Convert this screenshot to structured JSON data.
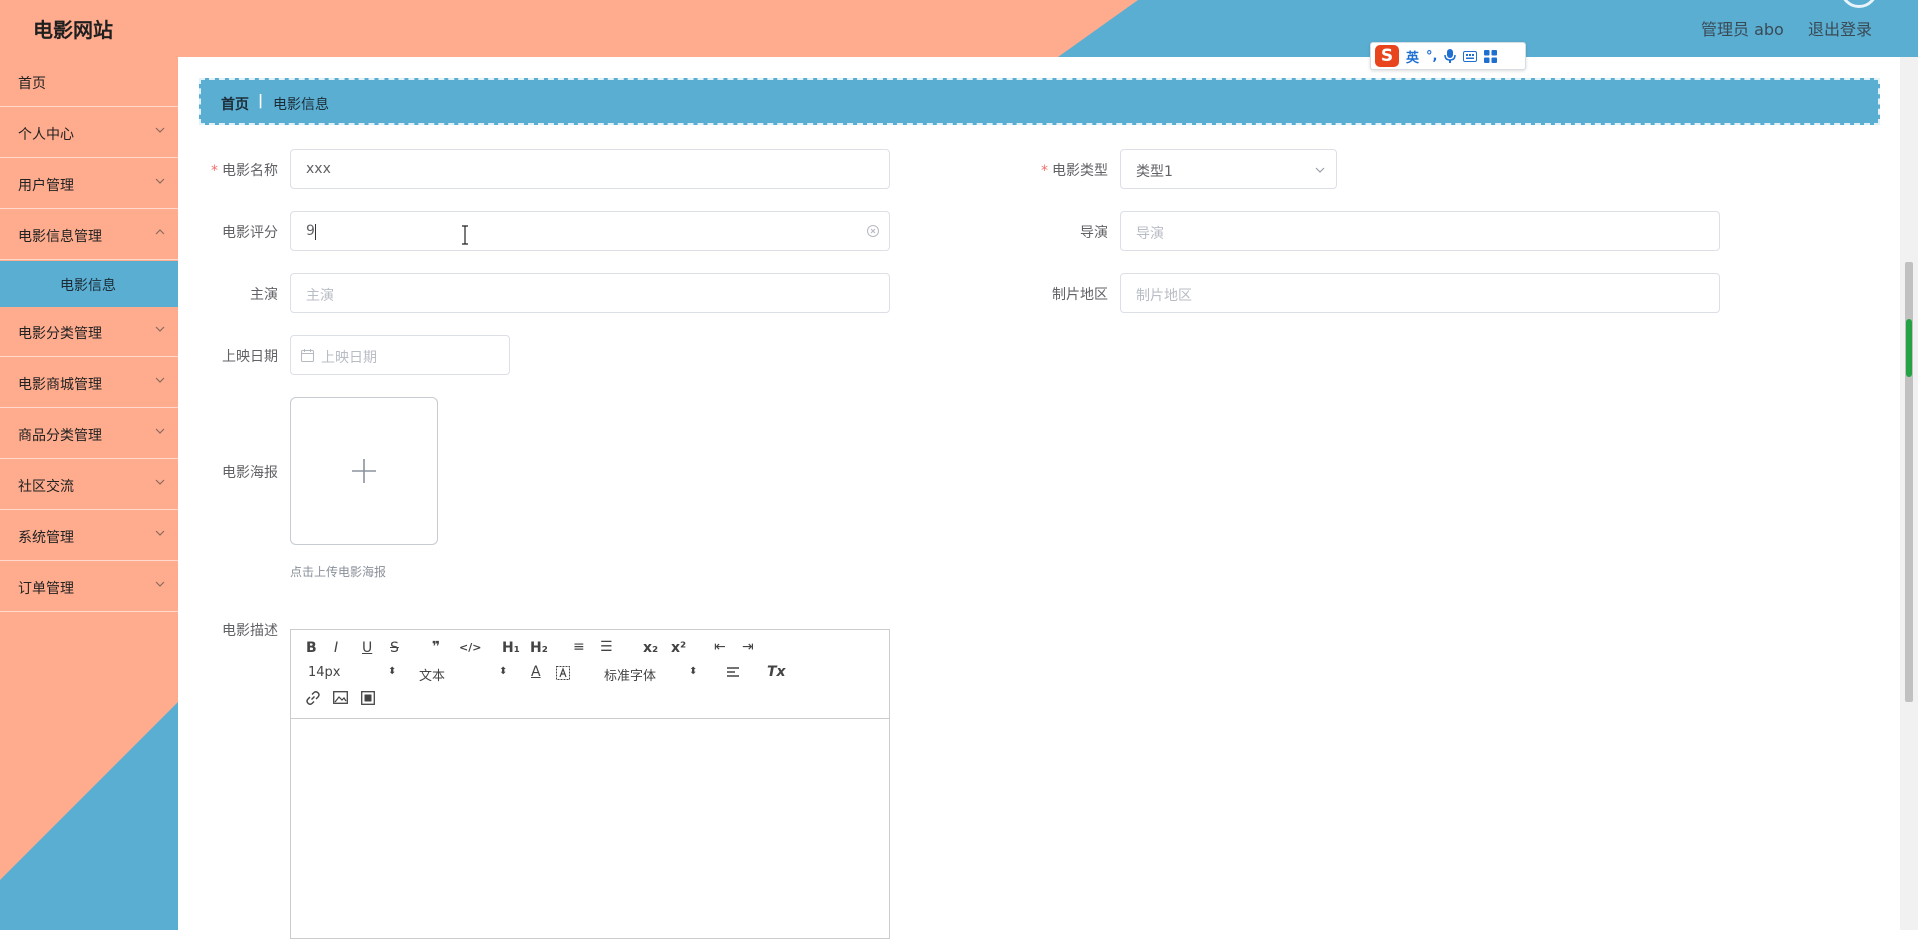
{
  "header": {
    "site_title": "电影网站",
    "user_label": "管理员 abo",
    "logout_label": "退出登录"
  },
  "ime": {
    "logo": "S",
    "lang": "英",
    "punct": "°,"
  },
  "sidebar": {
    "items": [
      {
        "label": "首页"
      },
      {
        "label": "个人中心"
      },
      {
        "label": "用户管理"
      },
      {
        "label": "电影信息管理"
      },
      {
        "label": "电影信息"
      },
      {
        "label": "电影分类管理"
      },
      {
        "label": "电影商城管理"
      },
      {
        "label": "商品分类管理"
      },
      {
        "label": "社区交流"
      },
      {
        "label": "系统管理"
      },
      {
        "label": "订单管理"
      }
    ]
  },
  "breadcrumb": {
    "home": "首页",
    "sep": "|",
    "current": "电影信息"
  },
  "form": {
    "name_label": "电影名称",
    "name_value": "xxx",
    "type_label": "电影类型",
    "type_value": "类型1",
    "score_label": "电影评分",
    "score_value": "9",
    "director_label": "导演",
    "director_placeholder": "导演",
    "actor_label": "主演",
    "actor_placeholder": "主演",
    "region_label": "制片地区",
    "region_placeholder": "制片地区",
    "date_label": "上映日期",
    "date_placeholder": "上映日期",
    "poster_label": "电影海报",
    "poster_tip": "点击上传电影海报",
    "desc_label": "电影描述",
    "required_mark": "*"
  },
  "editor": {
    "bold": "B",
    "italic": "I",
    "underline": "U",
    "strike": "S",
    "quote": "❞",
    "code": "</>",
    "h1": "H₁",
    "h2": "H₂",
    "ordered_list": "≡",
    "bullet_list": "☰",
    "subscript": "x₂",
    "superscript": "x²",
    "outdent": "⇤",
    "indent": "⇥",
    "size": "14px",
    "heading": "文本",
    "font": "标准字体",
    "color": "A",
    "clean": "Tx"
  }
}
